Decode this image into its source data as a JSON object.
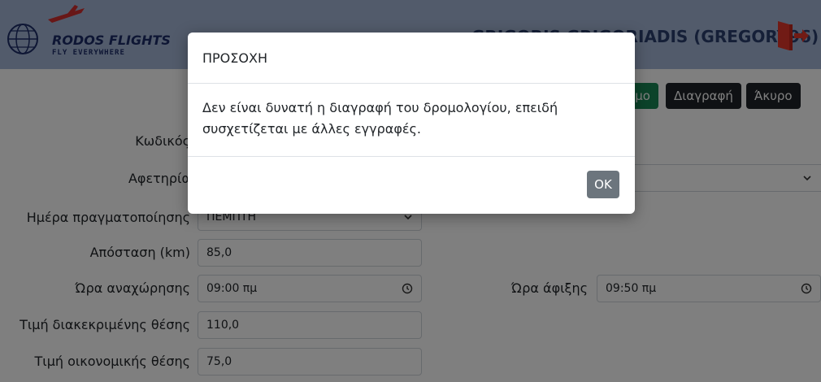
{
  "header": {
    "logo_title": "RODOS FLIGHTS",
    "logo_subtitle": "FLY EVERYWHERE",
    "user_display": "GRIGORIS GRIGORIADIS (GREGORY96)"
  },
  "toolbar": {
    "save_label": "μο",
    "delete_label": "Διαγραφή",
    "cancel_label": "Άκυρο"
  },
  "form": {
    "code_label": "Κωδικός",
    "origin_label": "Αφετηρία",
    "day_label": "Ημέρα πραγματοποίησης",
    "day_value": "ΠΕΜΠΤΗ",
    "distance_label": "Απόσταση (km)",
    "distance_value": "85,0",
    "departure_label": "Ώρα αναχώρησης",
    "departure_value": "09:00 πμ",
    "arrival_label": "Ώρα άφιξης",
    "arrival_value": "09:50 πμ",
    "business_price_label": "Τιμή διακεκριμένης θέσης",
    "business_price_value": "110,0",
    "economy_price_label": "Τιμή οικονομικής θέσης",
    "economy_price_value": "75,0"
  },
  "modal": {
    "title": "ΠΡΟΣΟΧΗ",
    "message": "Δεν είναι δυνατή η διαγραφή του δρομολογίου, επειδή συσχετίζεται με άλλες εγγραφές.",
    "ok_label": "OK"
  },
  "colors": {
    "navbar": "#a4b7d6",
    "save_button": "#198754",
    "dark_button": "#1f2328",
    "ok_button": "#6c757d",
    "logout_icon": "#e2372b"
  }
}
